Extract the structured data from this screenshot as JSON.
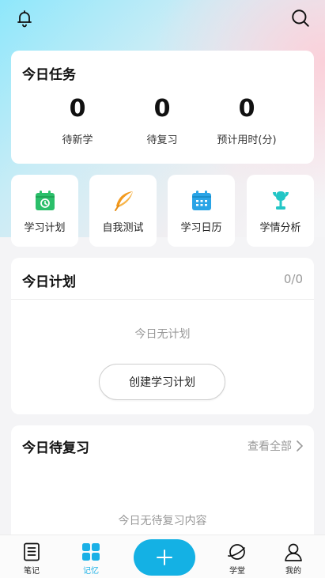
{
  "task_card": {
    "title": "今日任务",
    "stats": [
      {
        "value": "0",
        "label": "待新学"
      },
      {
        "value": "0",
        "label": "待复习"
      },
      {
        "value": "0",
        "label": "预计用时(分)"
      }
    ]
  },
  "quick_actions": [
    {
      "label": "学习计划",
      "icon": "calendar-check-icon",
      "color": "#2bbf6a"
    },
    {
      "label": "自我测试",
      "icon": "feather-icon",
      "color": "#f39a1e"
    },
    {
      "label": "学习日历",
      "icon": "calendar-grid-icon",
      "color": "#2aa4e6"
    },
    {
      "label": "学情分析",
      "icon": "trophy-icon",
      "color": "#23c6c6"
    }
  ],
  "plan_card": {
    "title": "今日计划",
    "count": "0/0",
    "empty_text": "今日无计划",
    "create_button": "创建学习计划"
  },
  "review_card": {
    "title": "今日待复习",
    "view_all": "查看全部",
    "empty_text": "今日无待复习内容"
  },
  "bottom_nav": [
    {
      "label": "笔记",
      "icon": "notebook-icon"
    },
    {
      "label": "记忆",
      "icon": "grid-icon",
      "active": true
    },
    {
      "label": "",
      "icon": "plus-icon"
    },
    {
      "label": "学堂",
      "icon": "planet-icon"
    },
    {
      "label": "我的",
      "icon": "person-icon"
    }
  ],
  "colors": {
    "accent": "#14b1e4",
    "active_tab": "#1ab0e6",
    "muted_text": "#999999"
  }
}
